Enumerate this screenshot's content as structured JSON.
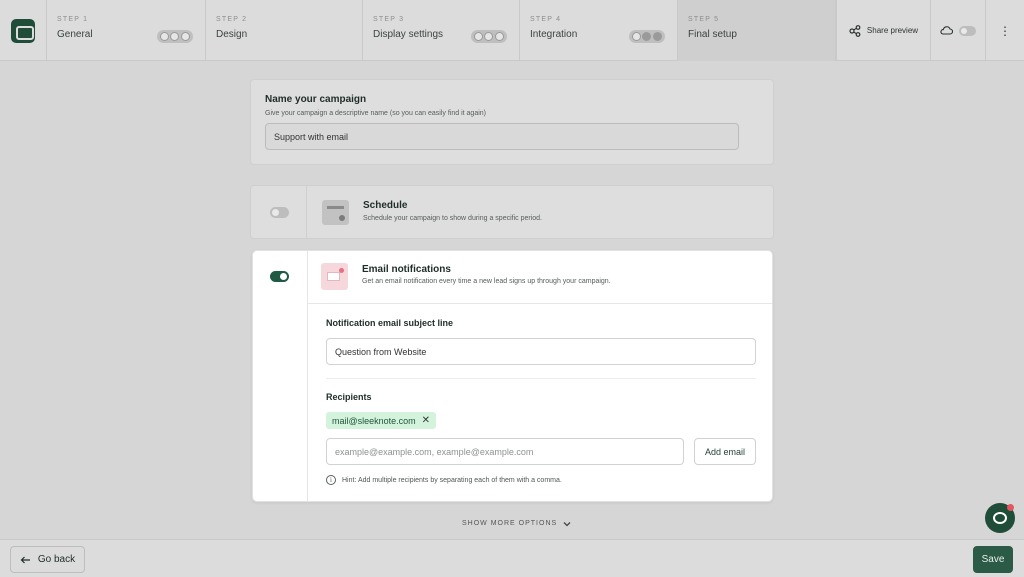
{
  "topbar": {
    "steps": [
      {
        "num": "STEP 1",
        "name": "General"
      },
      {
        "num": "STEP 2",
        "name": "Design"
      },
      {
        "num": "STEP 3",
        "name": "Display settings"
      },
      {
        "num": "STEP 4",
        "name": "Integration"
      },
      {
        "num": "STEP 5",
        "name": "Final setup"
      }
    ],
    "share_label": "Share preview",
    "more_icon": "⋮"
  },
  "name_card": {
    "title": "Name your campaign",
    "subtitle": "Give your campaign a descriptive name (so you can easily find it again)",
    "value": "Support with email"
  },
  "schedule_card": {
    "title": "Schedule",
    "subtitle": "Schedule your campaign to show during a specific period."
  },
  "email_card": {
    "title": "Email notifications",
    "subtitle": "Get an email notification every time a new lead signs up through your campaign.",
    "subject_label": "Notification email subject line",
    "subject_value": "Question from Website",
    "recipients_label": "Recipients",
    "recipient_chip": "mail@sleeknote.com",
    "chip_remove": "✕",
    "email_placeholder": "example@example.com, example@example.com",
    "add_email_label": "Add email",
    "hint": "Hint: Add multiple recipients by separating each of them with a comma."
  },
  "show_more": "SHOW MORE OPTIONS",
  "bottombar": {
    "back_label": "Go back",
    "save_label": "Save"
  },
  "colors": {
    "brand": "#1f4d3a",
    "save": "#2b5a47",
    "chip_bg": "#d4f3dc",
    "notification_dot": "#e3565f"
  }
}
